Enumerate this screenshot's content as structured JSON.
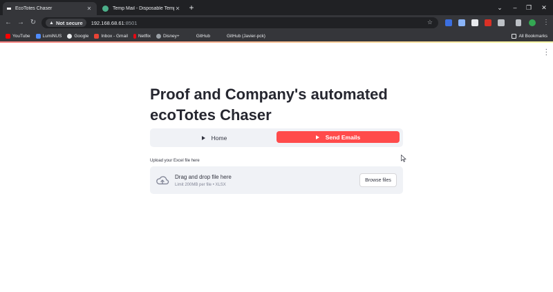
{
  "browser": {
    "tabs": [
      {
        "title": "EcoTotes Chaser",
        "active": true
      },
      {
        "title": "Temp Mail - Disposable Tempo",
        "active": false
      }
    ],
    "url": {
      "security_label": "Not secure",
      "host": "192.168.68.61",
      "port": ":8501"
    },
    "bookmarks": [
      "YouTube",
      "LumiNUS",
      "Google",
      "Inbox - Gmail",
      "Netflix",
      "Disney+",
      "GitHub",
      "GitHub (Javier-pck)"
    ],
    "all_bookmarks": "All Bookmarks"
  },
  "page": {
    "title": "Proof and Company's automated ecoTotes Chaser",
    "nav": {
      "home": "Home",
      "send": "Send Emails"
    },
    "uploader": {
      "label": "Upload your Excel file here",
      "drag_text": "Drag and drop file here",
      "limit_text": "Limit 200MB per file • XLSX",
      "browse_label": "Browse files"
    }
  },
  "colors": {
    "accent": "#ff4b4b",
    "panel": "#f0f2f6",
    "text": "#262730"
  },
  "icons": [
    "upload-cloud-icon",
    "play-icon",
    "star-icon",
    "kebab-menu-icon"
  ]
}
